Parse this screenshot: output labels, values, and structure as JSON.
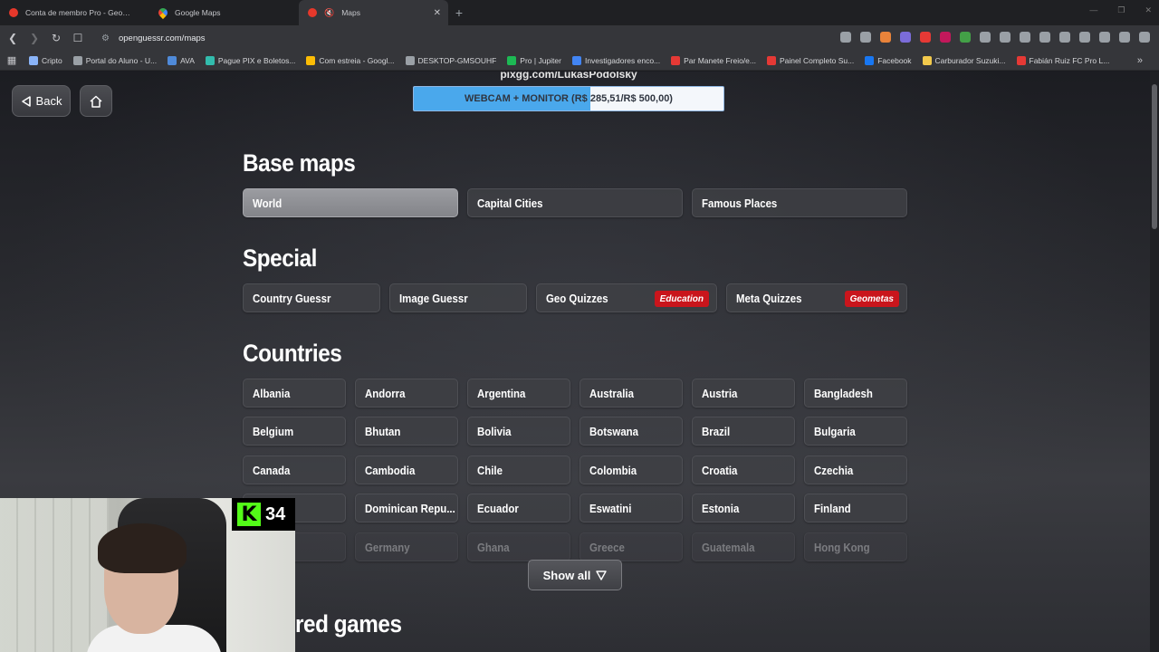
{
  "browser": {
    "tabs": [
      {
        "title": "Conta de membro Pro - GeoGuessr",
        "icon": "geoguessr-pin-icon",
        "active": false
      },
      {
        "title": "Google Maps",
        "icon": "google-maps-icon",
        "active": false
      },
      {
        "title": "Maps",
        "icon": "openguessr-icon",
        "active": true
      }
    ],
    "url": "openguessr.com/maps",
    "bookmarks": [
      {
        "label": "Cripto",
        "color": "#8ab4f8"
      },
      {
        "label": "Portal do Aluno - U...",
        "color": "#9aa0a6"
      },
      {
        "label": "AVA",
        "color": "#4f8ad9"
      },
      {
        "label": "Pague PIX e Boletos...",
        "color": "#32bcad"
      },
      {
        "label": "Com estreia - Googl...",
        "color": "#fbbc05"
      },
      {
        "label": "DESKTOP-GMSOUHF",
        "color": "#9aa0a6"
      },
      {
        "label": "Pro | Jupiter",
        "color": "#1db954"
      },
      {
        "label": "Investigadores enco...",
        "color": "#4285f4"
      },
      {
        "label": "Par Manete Freio/e...",
        "color": "#e53935"
      },
      {
        "label": "Painel Completo Su...",
        "color": "#e53935"
      },
      {
        "label": "Facebook",
        "color": "#1877f2"
      },
      {
        "label": "Carburador Suzuki...",
        "color": "#f2c94c"
      },
      {
        "label": "Fabián Ruiz FC Pro L...",
        "color": "#e53935"
      }
    ]
  },
  "nav": {
    "back_label": "Back"
  },
  "donation": {
    "pix_text": "pixgg.com/LukasPodolsky",
    "label": "WEBCAM + MONITOR (R$ 285,51/R$ 500,00)",
    "progress": 0.571
  },
  "sections": {
    "base_maps": {
      "title": "Base maps",
      "items": [
        "World",
        "Capital Cities",
        "Famous Places"
      ],
      "selected": "World"
    },
    "special": {
      "title": "Special",
      "items": [
        {
          "label": "Country Guessr",
          "tag": ""
        },
        {
          "label": "Image Guessr",
          "tag": ""
        },
        {
          "label": "Geo Quizzes",
          "tag": "Education"
        },
        {
          "label": "Meta Quizzes",
          "tag": "Geometas"
        }
      ]
    },
    "countries": {
      "title": "Countries",
      "rows": [
        [
          "Albania",
          "Andorra",
          "Argentina",
          "Australia",
          "Austria",
          "Bangladesh"
        ],
        [
          "Belgium",
          "Bhutan",
          "Bolivia",
          "Botswana",
          "Brazil",
          "Bulgaria"
        ],
        [
          "Canada",
          "Cambodia",
          "Chile",
          "Colombia",
          "Croatia",
          "Czechia"
        ],
        [
          "",
          "Dominican Repu...",
          "Ecuador",
          "Eswatini",
          "Estonia",
          "Finland"
        ],
        [
          "",
          "Germany",
          "Ghana",
          "Greece",
          "Guatemala",
          "Hong Kong"
        ]
      ],
      "show_all": "Show all"
    },
    "featured": {
      "title": "red games"
    }
  },
  "stream_overlay": {
    "kick_count": "34"
  },
  "colors": {
    "accent_blue": "#4aa8ec",
    "tag_red": "#c9151c",
    "kick_green": "#53fc18"
  }
}
